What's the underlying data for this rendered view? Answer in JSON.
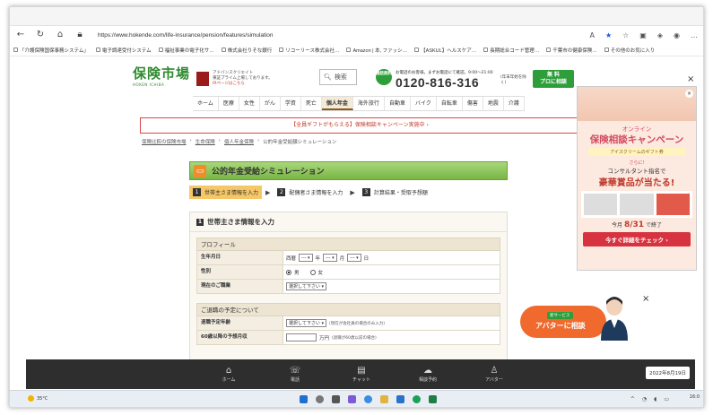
{
  "browser": {
    "url": "https://www.hokende.com/life-insurance/pension/features/simulation",
    "bookmarks": [
      "「介護保険国保事務システム」",
      "電子調達受付システム",
      "福祉事業の電子化サ…",
      "株式会社りそな銀行",
      "リコーリース株式会社…",
      "Amazon | 本, ファッシ…",
      "【ASKUL】ヘルスケア…",
      "長期総合コード管理…",
      "千葉市の健康保険…",
      "その他のお気に入り"
    ]
  },
  "header": {
    "logo_main": "保険市場",
    "logo_sub": "HOKEN ICHIBA",
    "partner_lines": [
      "アドバンスクリエイト",
      "東証プライム上場しております。"
    ],
    "partner_link": "IRページはこちら",
    "search_label": "検索",
    "free_badge": "通話無料",
    "tel_caption": "お電話のお客様。まずお電話にて確認。9:00〜21:00",
    "tel": "0120-816-316",
    "tel_note": "(年末年始を除く)",
    "consult_small": "無 料",
    "consult_label": "プロに相談"
  },
  "nav": {
    "items": [
      "ホーム",
      "医療",
      "女性",
      "がん",
      "学資",
      "死亡",
      "個人年金",
      "海外旅行",
      "自動車",
      "バイク",
      "自転車",
      "傷害",
      "地震",
      "介護"
    ],
    "active_index": 6
  },
  "campaign": "【全員ギフトがもらえる】保険相談キャンペーン実施中 ›",
  "breadcrumb": [
    "保険比較の保険市場",
    "生命保険",
    "個人年金保険",
    "公的年金受給額シミュレーション"
  ],
  "page": {
    "title": "公的年金受給シミュレーション",
    "steps": [
      {
        "num": "1",
        "label": "世帯主さま情報を入力"
      },
      {
        "num": "2",
        "label": "配偶者さま情報を入力"
      },
      {
        "num": "3",
        "label": "計算結果・受取予想額"
      }
    ],
    "panel_num": "1",
    "panel_title": "世帯主さま情報を入力",
    "profile_head": "プロフィール",
    "birth_label": "生年月日",
    "era": "西暦",
    "dash": "---",
    "year": "年",
    "month": "月",
    "day": "日",
    "gender_label": "性別",
    "male": "男",
    "female": "女",
    "job_label": "現在のご職業",
    "select_placeholder": "選択して下さい",
    "retire_head": "ご退職の予定について",
    "retire_age_label": "退職予定年齢",
    "retire_note": "(現在が会社員の場合のみ入力)",
    "income_label": "60歳以降の予想月収",
    "income_unit": "万円",
    "income_note": "(退職が60歳以前の場合)"
  },
  "ad": {
    "line1": "オンライン",
    "line2": "保険相談キャンペーン",
    "line3": "アイスクリームのギフト券",
    "line4": "さらに!",
    "line5": "コンサルタント指名で",
    "line6": "豪華賞品が当たる!",
    "end_prefix": "今月",
    "end_date": "8/31",
    "end_suffix": "で終了",
    "cta": "今すぐ詳細をチェック ›"
  },
  "avatar": {
    "tag": "新サービス",
    "label": "アバターに相談"
  },
  "appbar": {
    "items": [
      {
        "icon": "⌂",
        "label": "ホーム"
      },
      {
        "icon": "☏",
        "label": "電話"
      },
      {
        "icon": "▤",
        "label": "チャット"
      },
      {
        "icon": "☁",
        "label": "相談予約"
      },
      {
        "icon": "♙",
        "label": "アバター"
      }
    ],
    "date": "2022年8月19日"
  },
  "taskbar": {
    "weather": "35°C",
    "clock": "16:0"
  }
}
